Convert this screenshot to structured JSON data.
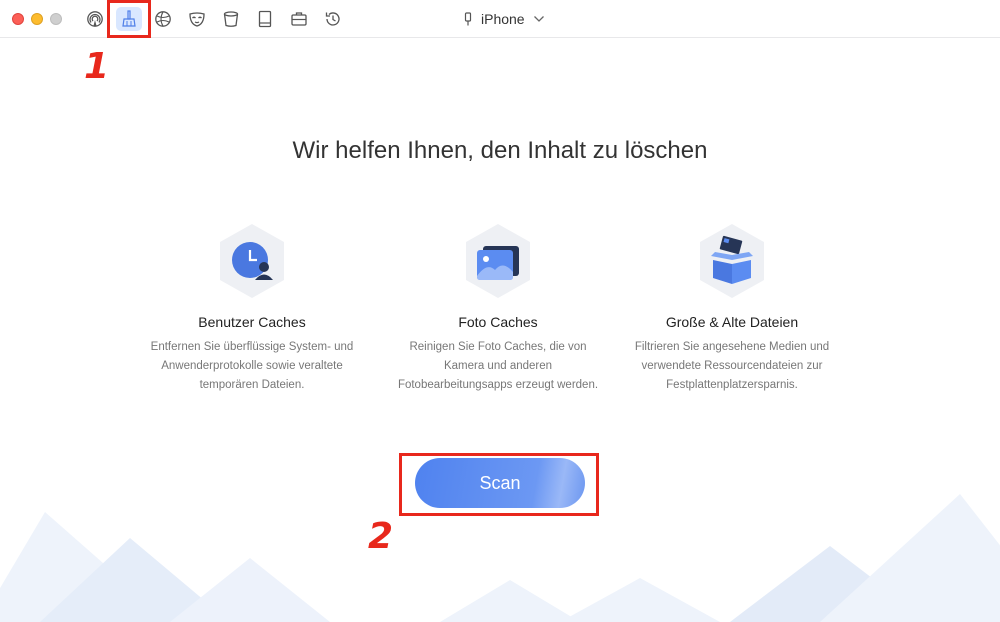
{
  "toolbar": {
    "icons": [
      "airdrop-icon",
      "cleaner-broom-icon",
      "browser-icon",
      "privacy-mask-icon",
      "trash-bin-icon",
      "book-icon",
      "briefcase-icon",
      "history-icon"
    ],
    "active_icon": "cleaner-broom-icon"
  },
  "device": {
    "name": "iPhone",
    "icon": "phone-cable-icon"
  },
  "main": {
    "headline": "Wir helfen Ihnen, den Inhalt zu löschen",
    "features": [
      {
        "icon": "user-clock-icon",
        "title": "Benutzer Caches",
        "description": "Entfernen Sie überflüssige System- und Anwenderprotokolle sowie veraltete temporären Dateien."
      },
      {
        "icon": "photo-icon",
        "title": "Foto Caches",
        "description": "Reinigen Sie Foto Caches, die von Kamera und anderen Fotobearbeitungsapps erzeugt werden."
      },
      {
        "icon": "open-box-icon",
        "title": "Große & Alte Dateien",
        "description": "Filtrieren Sie angesehene Medien und verwendete Ressourcendateien zur Festplattenplatzersparnis."
      }
    ],
    "scan_label": "Scan"
  },
  "annotations": {
    "step1": "1",
    "step2": "2"
  },
  "colors": {
    "accent": "#5b8cf1",
    "annotation_red": "#e8281c",
    "active_tool_bg": "#d9e7ff"
  }
}
